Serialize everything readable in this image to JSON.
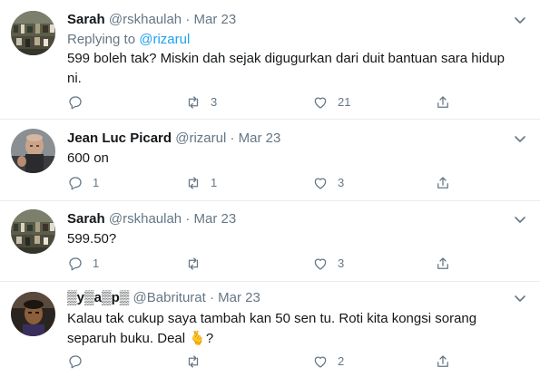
{
  "tweets": [
    {
      "display_name": "Sarah",
      "handle": "@rskhaulah",
      "sep": "·",
      "date": "Mar 23",
      "replying_prefix": "Replying to",
      "replying_to": "@rizarul",
      "text": "599 boleh tak? Miskin dah sejak digugurkan dari duit bantuan sara hidup ni.",
      "replies": "",
      "retweets": "3",
      "likes": "21",
      "avatar": "crowd-photo",
      "colors": {
        "bg": "#6b6a55",
        "fg": "#2f2e25"
      }
    },
    {
      "display_name": "Jean Luc Picard",
      "handle": "@rizarul",
      "sep": "·",
      "date": "Mar 23",
      "text": "600 on",
      "replies": "1",
      "retweets": "1",
      "likes": "3",
      "avatar": "bald-man-photo"
    },
    {
      "display_name": "Sarah",
      "handle": "@rskhaulah",
      "sep": "·",
      "date": "Mar 23",
      "text": "599.50?",
      "replies": "1",
      "retweets": "",
      "likes": "3",
      "avatar": "crowd-photo"
    },
    {
      "display_name": "▒y▒a▒p▒",
      "handle": "@Babriturat",
      "sep": "·",
      "date": "Mar 23",
      "text": "Kalau tak cukup saya tambah kan 50 sen tu. Roti kita kongsi sorang separuh buku. Deal 🫰?",
      "replies": "",
      "retweets": "",
      "likes": "2",
      "avatar": "person-photo"
    }
  ],
  "colors": {
    "text": "#14171a",
    "meta": "#657786",
    "link": "#1da1f2",
    "divider": "#e6ecf0"
  }
}
